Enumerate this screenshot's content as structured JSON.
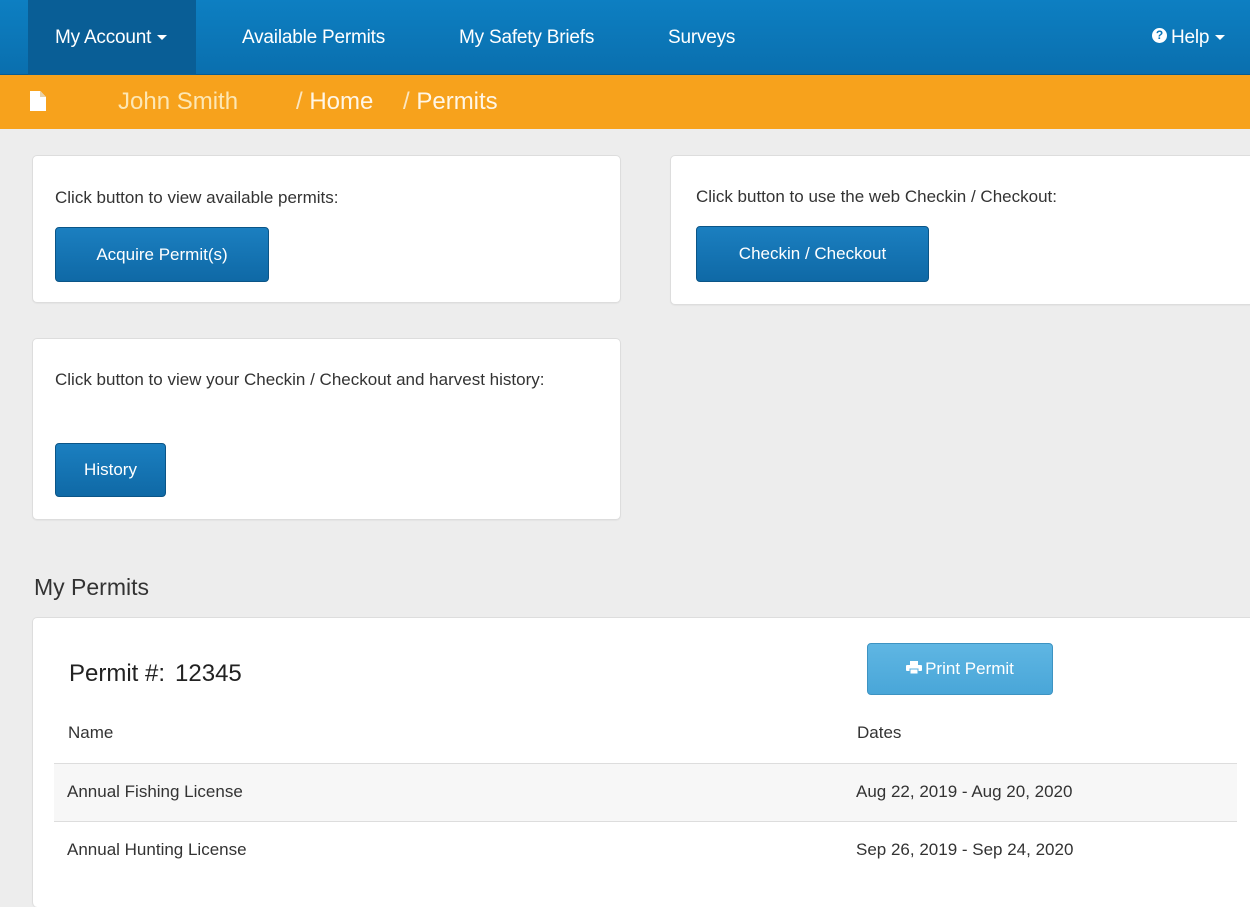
{
  "nav": {
    "my_account": "My Account",
    "available_permits": "Available Permits",
    "safety_briefs": "My Safety Briefs",
    "surveys": "Surveys",
    "help": "Help"
  },
  "breadcrumb": {
    "user": "John Smith",
    "items": [
      "Home",
      "Permits"
    ],
    "separator": "/"
  },
  "cards": {
    "permits": {
      "text": "Click button to view available permits:",
      "button": "Acquire Permit(s)"
    },
    "checkin": {
      "text": "Click button to use the web Checkin / Checkout:",
      "button": "Checkin / Checkout"
    },
    "history": {
      "text": "Click button to view your Checkin / Checkout and harvest history:",
      "button": "History"
    }
  },
  "my_permits": {
    "title": "My Permits",
    "permit_label": "Permit #:",
    "permit_number": "12345",
    "print_button": "Print Permit",
    "columns": [
      "Name",
      "Dates"
    ],
    "rows": [
      {
        "name": "Annual Fishing License",
        "dates": "Aug 22, 2019 - Aug 20, 2020"
      },
      {
        "name": "Annual Hunting License",
        "dates": "Sep 26, 2019 - Sep 24, 2020"
      }
    ]
  },
  "colors": {
    "navbar": "#0b76b8",
    "breadcrumb_bar": "#f7a21c",
    "primary_button": "#1575b5",
    "info_button": "#54afdf",
    "background": "#ededed"
  },
  "icons": {
    "breadcrumb": "document-icon",
    "help": "question-circle-icon",
    "print": "printer-icon"
  }
}
